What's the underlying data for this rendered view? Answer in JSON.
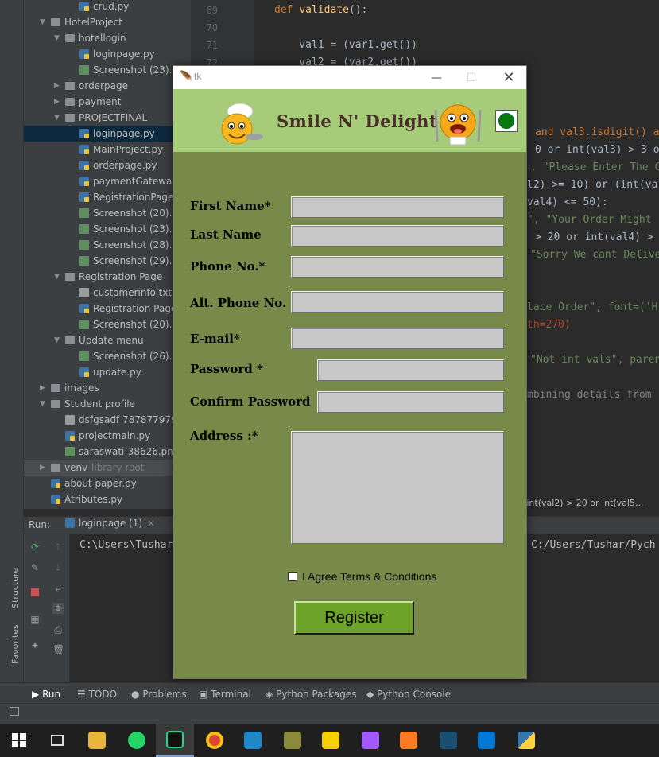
{
  "project_tree": [
    {
      "label": "crud.py",
      "type": "py",
      "indent": 3,
      "arrow": ""
    },
    {
      "label": "HotelProject",
      "type": "folder",
      "indent": 1,
      "arrow": "down"
    },
    {
      "label": "hotellogin",
      "type": "folder",
      "indent": 2,
      "arrow": "down"
    },
    {
      "label": "loginpage.py",
      "type": "py",
      "indent": 3,
      "arrow": ""
    },
    {
      "label": "Screenshot (23).p",
      "type": "img",
      "indent": 3,
      "arrow": ""
    },
    {
      "label": "orderpage",
      "type": "folder",
      "indent": 2,
      "arrow": "right"
    },
    {
      "label": "payment",
      "type": "folder",
      "indent": 2,
      "arrow": "right"
    },
    {
      "label": "PROJECTFINAL",
      "type": "folder",
      "indent": 2,
      "arrow": "down"
    },
    {
      "label": "loginpage.py",
      "type": "py",
      "indent": 3,
      "arrow": "",
      "selected": true
    },
    {
      "label": "MainProject.py",
      "type": "py",
      "indent": 3,
      "arrow": ""
    },
    {
      "label": "orderpage.py",
      "type": "py",
      "indent": 3,
      "arrow": ""
    },
    {
      "label": "paymentGateway",
      "type": "py",
      "indent": 3,
      "arrow": ""
    },
    {
      "label": "RegistrationPage",
      "type": "py",
      "indent": 3,
      "arrow": ""
    },
    {
      "label": "Screenshot (20).p",
      "type": "img",
      "indent": 3,
      "arrow": ""
    },
    {
      "label": "Screenshot (23).p",
      "type": "img",
      "indent": 3,
      "arrow": ""
    },
    {
      "label": "Screenshot (28).p",
      "type": "img",
      "indent": 3,
      "arrow": ""
    },
    {
      "label": "Screenshot (29).p",
      "type": "img",
      "indent": 3,
      "arrow": ""
    },
    {
      "label": "Registration Page",
      "type": "folder",
      "indent": 2,
      "arrow": "down"
    },
    {
      "label": "customerinfo.txt",
      "type": "txt",
      "indent": 3,
      "arrow": ""
    },
    {
      "label": "Registration Page",
      "type": "py",
      "indent": 3,
      "arrow": ""
    },
    {
      "label": "Screenshot (20).p",
      "type": "img",
      "indent": 3,
      "arrow": ""
    },
    {
      "label": "Update menu",
      "type": "folder",
      "indent": 2,
      "arrow": "down"
    },
    {
      "label": "Screenshot (26).p",
      "type": "img",
      "indent": 3,
      "arrow": ""
    },
    {
      "label": "update.py",
      "type": "py",
      "indent": 3,
      "arrow": ""
    },
    {
      "label": "images",
      "type": "folder",
      "indent": 1,
      "arrow": "right"
    },
    {
      "label": "Student profile",
      "type": "folder",
      "indent": 1,
      "arrow": "down"
    },
    {
      "label": "dsfgsadf 7878779797",
      "type": "txt",
      "indent": 2,
      "arrow": ""
    },
    {
      "label": "projectmain.py",
      "type": "py",
      "indent": 2,
      "arrow": ""
    },
    {
      "label": "saraswati-38626.png",
      "type": "img",
      "indent": 2,
      "arrow": ""
    },
    {
      "label": "venv",
      "type": "folder",
      "indent": 1,
      "arrow": "right",
      "suffix": "library root",
      "venv": true
    },
    {
      "label": "about paper.py",
      "type": "py",
      "indent": 1,
      "arrow": ""
    },
    {
      "label": "Atributes.py",
      "type": "py",
      "indent": 1,
      "arrow": ""
    }
  ],
  "editor": {
    "line_numbers": [
      "69",
      "70",
      "71",
      "72"
    ],
    "def_kw": "def",
    "def_name": "validate",
    "def_rest": "():",
    "line71": "    val1 = (var1.get())",
    "line72": "    val2 = (var2.get())",
    "frag1": "and val3.isdigit() a",
    "frag2": "0 or int(val3) > 3 o",
    "frag3": ", \"Please Enter The C",
    "frag4": "l2) >= 10) or (int(va",
    "frag5": "val4) <= 50):",
    "frag6": "\", \"Your Order Might",
    "frag7": "> 20 or int(val4) >",
    "frag8": "\"Sorry We cant Delive",
    "frag9": "lace Order\", font=('H",
    "frag10": "th=270)",
    "frag11": "\"Not int vals\", paren",
    "frag12": "mbining details from",
    "breadcrumb": "f int(val2) > 20 or int(val5..."
  },
  "run_panel": {
    "label": "Run:",
    "tab": "loginpage (1)",
    "console_left": "C:\\Users\\Tushar",
    "console_right": "C:/Users/Tushar/Pych"
  },
  "side_labels": {
    "structure": "Structure",
    "favorites": "Favorites"
  },
  "bottom_tabs": [
    {
      "label": "Run",
      "icon": "▶",
      "active": true
    },
    {
      "label": "TODO",
      "icon": "☰"
    },
    {
      "label": "Problems",
      "icon": "●"
    },
    {
      "label": "Terminal",
      "icon": "▣"
    },
    {
      "label": "Python Packages",
      "icon": "◈"
    },
    {
      "label": "Python Console",
      "icon": "◆"
    }
  ],
  "tk_window": {
    "title": "tk",
    "app_title": "Smile N' Delight",
    "fields": [
      {
        "label": "First Name*",
        "value": ""
      },
      {
        "label": "Last Name",
        "value": ""
      },
      {
        "label": "Phone No.*",
        "value": ""
      },
      {
        "label": "Alt. Phone No.",
        "value": ""
      },
      {
        "label": "E-mail*",
        "value": ""
      },
      {
        "label": "Password *",
        "value": ""
      },
      {
        "label": "Confirm Password",
        "value": ""
      },
      {
        "label": "Address :*",
        "value": ""
      }
    ],
    "agree_label": "I Agree Terms & Conditions",
    "register_label": "Register"
  },
  "colors": {
    "header_bg": "#a6cc7a",
    "body_bg": "#778a4a",
    "button_bg": "#6ea32a",
    "input_bg": "#c8c8c8"
  }
}
